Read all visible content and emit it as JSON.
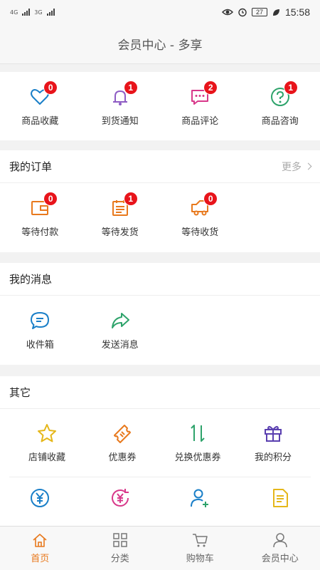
{
  "status_bar": {
    "net1": "4G",
    "net2": "3G",
    "battery": "27",
    "time": "15:58"
  },
  "header": {
    "title": "会员中心 - 多享"
  },
  "quick": [
    {
      "label": "商品收藏",
      "badge": "0",
      "icon": "heart-icon"
    },
    {
      "label": "到货通知",
      "badge": "1",
      "icon": "bell-icon"
    },
    {
      "label": "商品评论",
      "badge": "2",
      "icon": "comment-icon"
    },
    {
      "label": "商品咨询",
      "badge": "1",
      "icon": "question-icon"
    }
  ],
  "orders": {
    "title": "我的订单",
    "more": "更多",
    "items": [
      {
        "label": "等待付款",
        "badge": "0",
        "icon": "wallet-icon"
      },
      {
        "label": "等待发货",
        "badge": "1",
        "icon": "clipboard-icon"
      },
      {
        "label": "等待收货",
        "badge": "0",
        "icon": "truck-icon"
      }
    ]
  },
  "messages": {
    "title": "我的消息",
    "items": [
      {
        "label": "收件箱",
        "icon": "message-bubble-icon"
      },
      {
        "label": "发送消息",
        "icon": "share-arrow-icon"
      }
    ]
  },
  "others": {
    "title": "其它",
    "items": [
      {
        "label": "店铺收藏",
        "icon": "star-icon"
      },
      {
        "label": "优惠券",
        "icon": "ticket-icon"
      },
      {
        "label": "兑换优惠券",
        "icon": "exchange-icon"
      },
      {
        "label": "我的积分",
        "icon": "gift-icon"
      }
    ],
    "row2": [
      {
        "icon": "yen-circle-icon"
      },
      {
        "icon": "yen-refresh-icon"
      },
      {
        "icon": "add-user-icon"
      },
      {
        "icon": "document-icon"
      }
    ]
  },
  "tabbar": [
    {
      "label": "首页",
      "icon": "home-icon",
      "active": true
    },
    {
      "label": "分类",
      "icon": "grid-icon",
      "active": false
    },
    {
      "label": "购物车",
      "icon": "cart-icon",
      "active": false
    },
    {
      "label": "会员中心",
      "icon": "user-icon",
      "active": false
    }
  ],
  "colors": {
    "accent": "#e8791d",
    "badge": "#e8141b",
    "blue": "#1a7fc8"
  }
}
